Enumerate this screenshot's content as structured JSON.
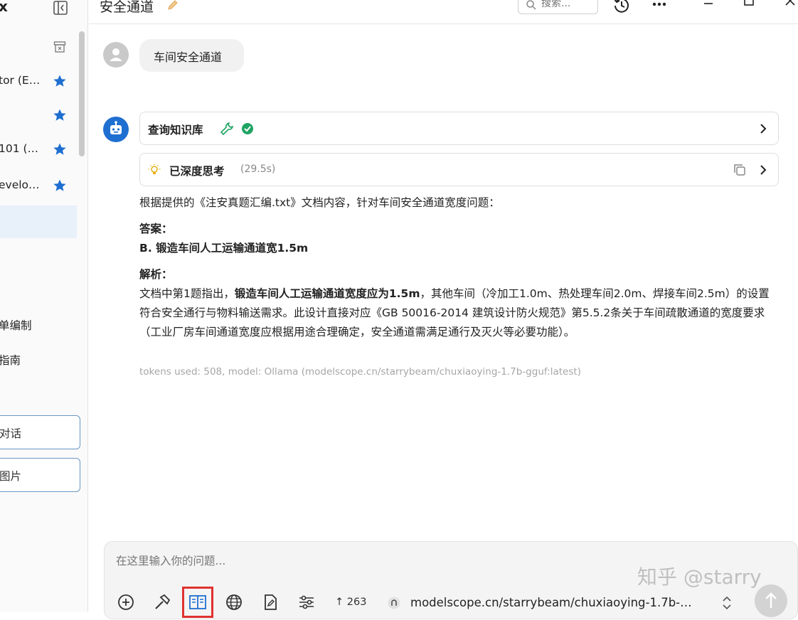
{
  "sidebar": {
    "title": "x",
    "items": [
      {
        "label": "tor (E…"
      },
      {
        "label": ""
      },
      {
        "label": "101 (…"
      },
      {
        "label": "evelo…"
      }
    ],
    "list_items": [
      "单编制",
      "指南"
    ],
    "buttons": [
      "对话",
      "图片"
    ],
    "bottom_text": ")"
  },
  "header": {
    "title": "安全通道",
    "search_placeholder": "搜索..."
  },
  "conversation": {
    "user_message": "车间安全通道",
    "tool_card_label": "查询知识库",
    "thinking_label": "已深度思考",
    "thinking_time": "(29.5s)",
    "answer_intro": "根据提供的《注安真题汇编.txt》文档内容，针对车间安全通道宽度问题：",
    "answer_heading": "答案：",
    "answer_value": "B. 锻造车间人工运输通道宽1.5m",
    "analysis_heading": "解析：",
    "analysis_p1": "文档中第1题指出，",
    "analysis_bold": "锻造车间人工运输通道宽度应为1.5m",
    "analysis_p2": "，其他车间（冷加工1.0m、热处理车间2.0m、焊接车间2.5m）的设置符合安全通行与物料输送需求。此设计直接对应《GB 50016-2014 建筑设计防火规范》第5.5.2条关于车间疏散通道的宽度要求（工业厂房车间通道宽度应根据用途合理确定，安全通道需满足通行及灭火等必要功能）。",
    "meta": "tokens used: 508, model: Ollama (modelscope.cn/starrybeam/chuxiaoying-1.7b-gguf:latest)"
  },
  "composer": {
    "placeholder": "在这里输入你的问题...",
    "token_count": "↑ 263",
    "model_label": "modelscope.cn/starrybeam/chuxiaoying-1.7b-…"
  },
  "watermark": "知乎 @starry",
  "colors": {
    "accent": "#1f6fd1",
    "success": "#1fa463",
    "highlight": "#e0322f"
  }
}
